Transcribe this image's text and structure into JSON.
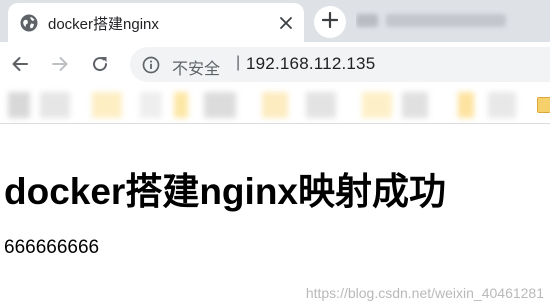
{
  "tab": {
    "title": "docker搭建nginx",
    "favicon": "globe-icon",
    "close": "close-icon",
    "new_tab": "plus-icon"
  },
  "toolbar": {
    "back": "back-arrow-icon",
    "forward": "forward-arrow-icon",
    "reload": "reload-icon",
    "security_icon": "info-icon",
    "security_label": "不安全",
    "separator": "|",
    "url": "192.168.112.135"
  },
  "page": {
    "heading": "docker搭建nginx映射成功",
    "text": "666666666"
  },
  "watermark": "https://blog.csdn.net/weixin_40461281",
  "colors": {
    "tabstrip": "#dee1e6",
    "omnibox": "#f1f3f4",
    "icon": "#5f6368",
    "favicon": "#5f6368",
    "folder": "#f6d16b"
  }
}
